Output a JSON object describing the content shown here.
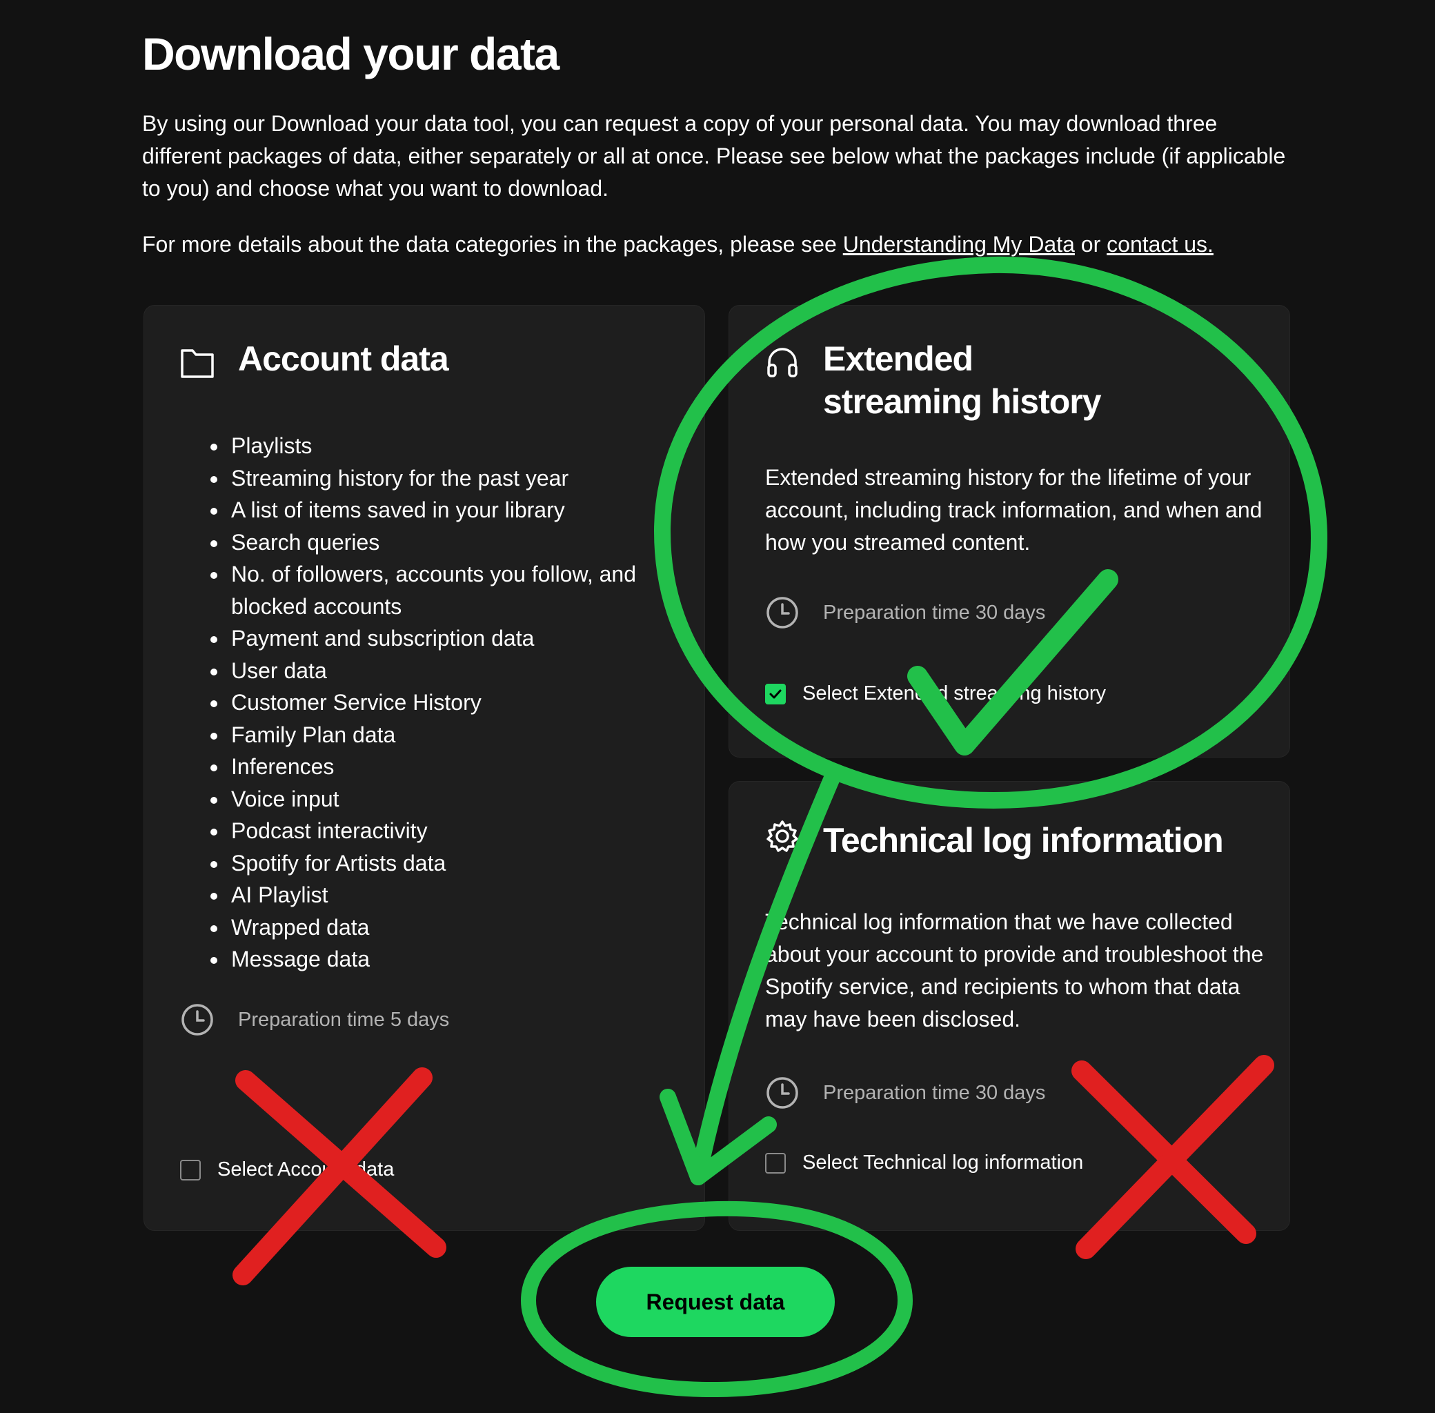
{
  "colors": {
    "background": "#121212",
    "card": "#1e1e1e",
    "accent_green": "#1ed760",
    "annotation_green": "#22c04a",
    "annotation_red": "#e02020",
    "muted_text": "#b3b3b3"
  },
  "page": {
    "title": "Download your data",
    "intro": "By using our Download your data tool, you can request a copy of your personal data. You may download three different packages of data, either separately or all at once. Please see below what the packages include (if applicable to you) and choose what you want to download.",
    "details_prefix": "For more details about the data categories in the packages, please see ",
    "details_link_understanding": "Understanding My Data",
    "details_or": " or ",
    "details_link_contact": "contact us."
  },
  "account_card": {
    "icon": "folder-icon",
    "title": "Account data",
    "items": [
      "Playlists",
      "Streaming history for the past year",
      "A list of items saved in your library",
      "Search queries",
      "No. of followers, accounts you follow, and blocked accounts",
      "Payment and subscription data",
      "User data",
      "Customer Service History",
      "Family Plan data",
      "Inferences",
      "Voice input",
      "Podcast interactivity",
      "Spotify for Artists data",
      "AI Playlist",
      "Wrapped data",
      "Message data"
    ],
    "prep_time": "Preparation time 5 days",
    "select_label": "Select Account data",
    "selected": false
  },
  "extended_card": {
    "icon": "headphones-icon",
    "title_line1": "Extended",
    "title_line2": "streaming history",
    "description": "Extended streaming history for the lifetime of your account, including track information, and when and how you streamed content.",
    "prep_time": "Preparation time 30 days",
    "select_label": "Select Extended streaming history",
    "selected": true
  },
  "technical_card": {
    "icon": "gear-icon",
    "title": "Technical log information",
    "description": "Technical log information that we have collected about your account to provide and troubleshoot the Spotify service, and recipients to whom that data may have been disclosed.",
    "prep_time": "Preparation time 30 days",
    "select_label": "Select Technical log information",
    "selected": false
  },
  "request_button": {
    "label": "Request data"
  },
  "annotations": [
    "green-circle-extended-history",
    "green-checkmark",
    "green-arrow-to-request-button",
    "green-circle-request-button",
    "red-x-account-data",
    "red-x-technical-log"
  ]
}
